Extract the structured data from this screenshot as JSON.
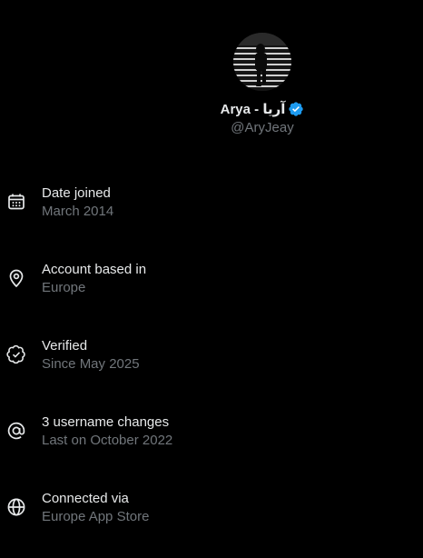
{
  "profile": {
    "display_name": "Arya - آریا",
    "handle": "@AryJeay",
    "verified": true,
    "verified_color": "#1d9bf0"
  },
  "about_items": [
    {
      "icon": "calendar-icon",
      "title": "Date joined",
      "value": "March 2014"
    },
    {
      "icon": "location-pin-icon",
      "title": "Account based in",
      "value": "Europe"
    },
    {
      "icon": "verified-check-icon",
      "title": "Verified",
      "value": "Since May 2025"
    },
    {
      "icon": "at-sign-icon",
      "title": "3 username changes",
      "value": "Last on October 2022"
    },
    {
      "icon": "globe-icon",
      "title": "Connected via",
      "value": "Europe App Store"
    }
  ],
  "colors": {
    "background": "#000000",
    "primary_text": "#e7e9ea",
    "secondary_text": "#71767b"
  }
}
